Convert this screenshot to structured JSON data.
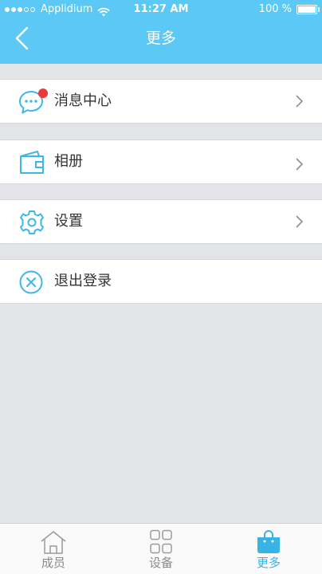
{
  "status_bar": {
    "carrier": "Applidium",
    "time": "11:27 AM",
    "battery": "100 %"
  },
  "nav": {
    "title": "更多",
    "back_icon": "chevron-left-icon"
  },
  "menu": [
    {
      "id": "messages",
      "label": "消息中心",
      "icon": "chat-bubble-icon",
      "has_badge": true,
      "has_chevron": true
    },
    {
      "id": "album",
      "label": "相册",
      "icon": "wallet-icon",
      "has_chevron": true
    },
    {
      "id": "settings",
      "label": "设置",
      "icon": "gear-icon",
      "has_chevron": true
    },
    {
      "id": "logout",
      "label": "退出登录",
      "icon": "close-circle-icon",
      "has_chevron": false
    }
  ],
  "tabs": [
    {
      "id": "members",
      "label": "成员",
      "icon": "house-icon",
      "active": false
    },
    {
      "id": "devices",
      "label": "设备",
      "icon": "grid-icon",
      "active": false
    },
    {
      "id": "more",
      "label": "更多",
      "icon": "shopping-bag-icon",
      "active": true
    }
  ],
  "colors": {
    "accent": "#5bc8f5",
    "icon_blue": "#3db8e6",
    "badge_red": "#e8393c",
    "background": "#e3e4e8",
    "tab_inactive": "#8a8a8a",
    "tab_active": "#38b3e6"
  }
}
